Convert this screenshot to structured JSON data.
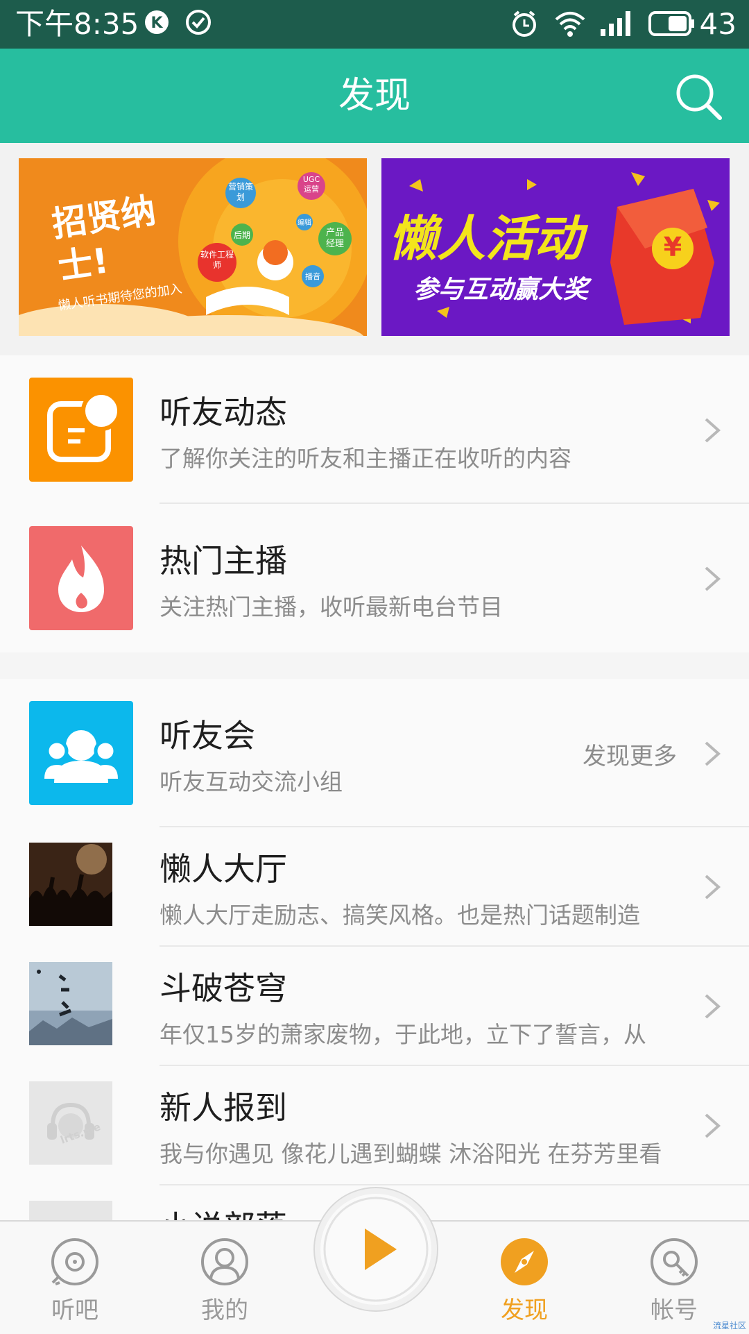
{
  "status_bar": {
    "time": "下午8:35",
    "battery": "43"
  },
  "app_bar": {
    "title": "发现"
  },
  "colors": {
    "app_bar": "#27be9f",
    "status_bar": "#1d5c4c",
    "accent": "#f0a020"
  },
  "banners": [
    {
      "headline": "招贤纳士!",
      "tagline": "懒人听书期待您的加入",
      "bubbles": [
        "营销策划",
        "UGC运营",
        "编辑",
        "后期",
        "产品经理",
        "软件工程师",
        "播音"
      ]
    },
    {
      "headline": "懒人活动",
      "tagline": "参与互动赢大奖",
      "coin": "¥"
    }
  ],
  "section1": [
    {
      "title": "听友动态",
      "subtitle": "了解你关注的听友和主播正在收听的内容",
      "icon": "feed-icon"
    },
    {
      "title": "热门主播",
      "subtitle": "关注热门主播，收听最新电台节目",
      "icon": "flame-icon"
    }
  ],
  "section2": {
    "header": {
      "title": "听友会",
      "subtitle": "听友互动交流小组",
      "more": "发现更多",
      "icon": "group-icon"
    },
    "items": [
      {
        "title": "懒人大厅",
        "subtitle": "懒人大厅走励志、搞笑风格。也是热门话题制造"
      },
      {
        "title": "斗破苍穹",
        "subtitle": " 年仅15岁的萧家废物，于此地，立下了誓言，从"
      },
      {
        "title": "新人报到",
        "subtitle": "我与你遇见 像花儿遇到蝴蝶 沐浴阳光 在芬芳里看"
      },
      {
        "title": "小说部落",
        "subtitle": ""
      }
    ],
    "placeholder_logo": "lrts.me"
  },
  "tabs": [
    {
      "label": "听吧",
      "icon": "disc-icon",
      "active": false
    },
    {
      "label": "我的",
      "icon": "user-icon",
      "active": false
    },
    {
      "label": "发现",
      "icon": "compass-icon",
      "active": true
    },
    {
      "label": "帐号",
      "icon": "account-key-icon",
      "active": false
    }
  ],
  "watermark": "流星社区"
}
